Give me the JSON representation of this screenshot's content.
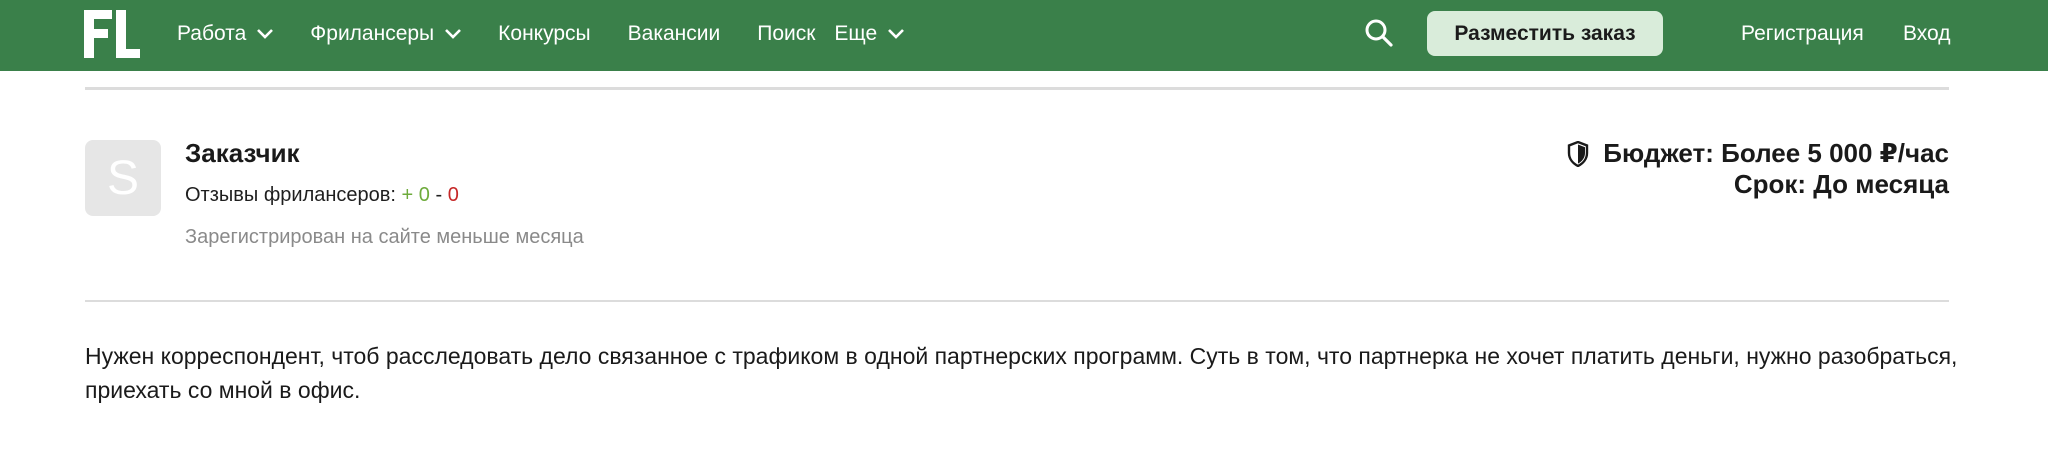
{
  "header": {
    "logo_text": "FL",
    "brand_color": "#3a804a",
    "nav": [
      {
        "label": "Работа",
        "has_dropdown": true
      },
      {
        "label": "Фрилансеры",
        "has_dropdown": true
      },
      {
        "label": "Конкурсы",
        "has_dropdown": false
      },
      {
        "label": "Вакансии",
        "has_dropdown": false
      },
      {
        "label": "Поиск",
        "has_dropdown": false
      },
      {
        "label": "Еще",
        "has_dropdown": true
      }
    ],
    "search_icon": "search-icon",
    "cta_label": "Разместить заказ",
    "register_label": "Регистрация",
    "login_label": "Вход"
  },
  "client": {
    "avatar_letter": "S",
    "name": "Заказчик",
    "reviews_label": "Отзывы фрилансеров:",
    "reviews_positive": "+ 0",
    "reviews_separator": "-",
    "reviews_negative": "0",
    "registered": "Зарегистрирован на сайте меньше месяца"
  },
  "project": {
    "budget": "Бюджет: Более 5 000 ₽/час",
    "deadline": "Срок: До месяца",
    "budget_icon": "shield-icon",
    "description": "Нужен корреспондент, чтоб расследовать дело связанное с трафиком в одной партнерских программ. Суть в том, что партнерка не хочет платить деньги, нужно разобраться, приехать со мной в офис."
  }
}
